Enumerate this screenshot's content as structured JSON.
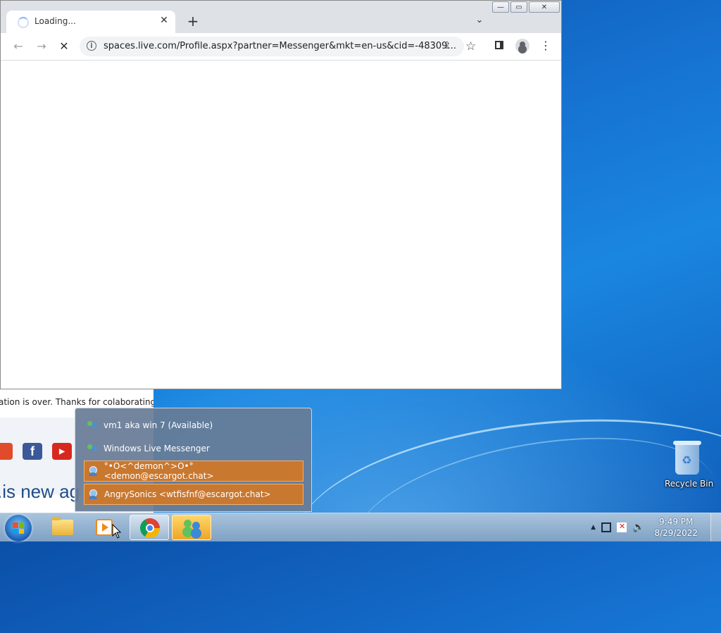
{
  "browser": {
    "tab_title": "Loading...",
    "tab_close": "✕",
    "new_tab": "+",
    "tab_search": "⌄",
    "url": "spaces.live.com/Profile.aspx?partner=Messenger&mkt=en-us&cid=-48309...",
    "caption": {
      "minimize": "—",
      "maximize": "▭",
      "close": "✕"
    }
  },
  "background_page": {
    "notice": "ation is over. Thanks for colaborating",
    "big_text": ".is new ag"
  },
  "jumplist": {
    "items": [
      {
        "label": "vm1 aka win 7 (Available)",
        "kind": "status"
      },
      {
        "label": "Windows Live Messenger",
        "kind": "app"
      },
      {
        "label": "°•O<^demon^>O•° <demon@escargot.chat>",
        "kind": "contact"
      },
      {
        "label": "AngrySonics <wtfisfnf@escargot.chat>",
        "kind": "contact"
      }
    ]
  },
  "desktop": {
    "recycle_bin": "Recycle Bin"
  },
  "taskbar": {
    "time": "9:49 PM",
    "date": "8/29/2022"
  }
}
